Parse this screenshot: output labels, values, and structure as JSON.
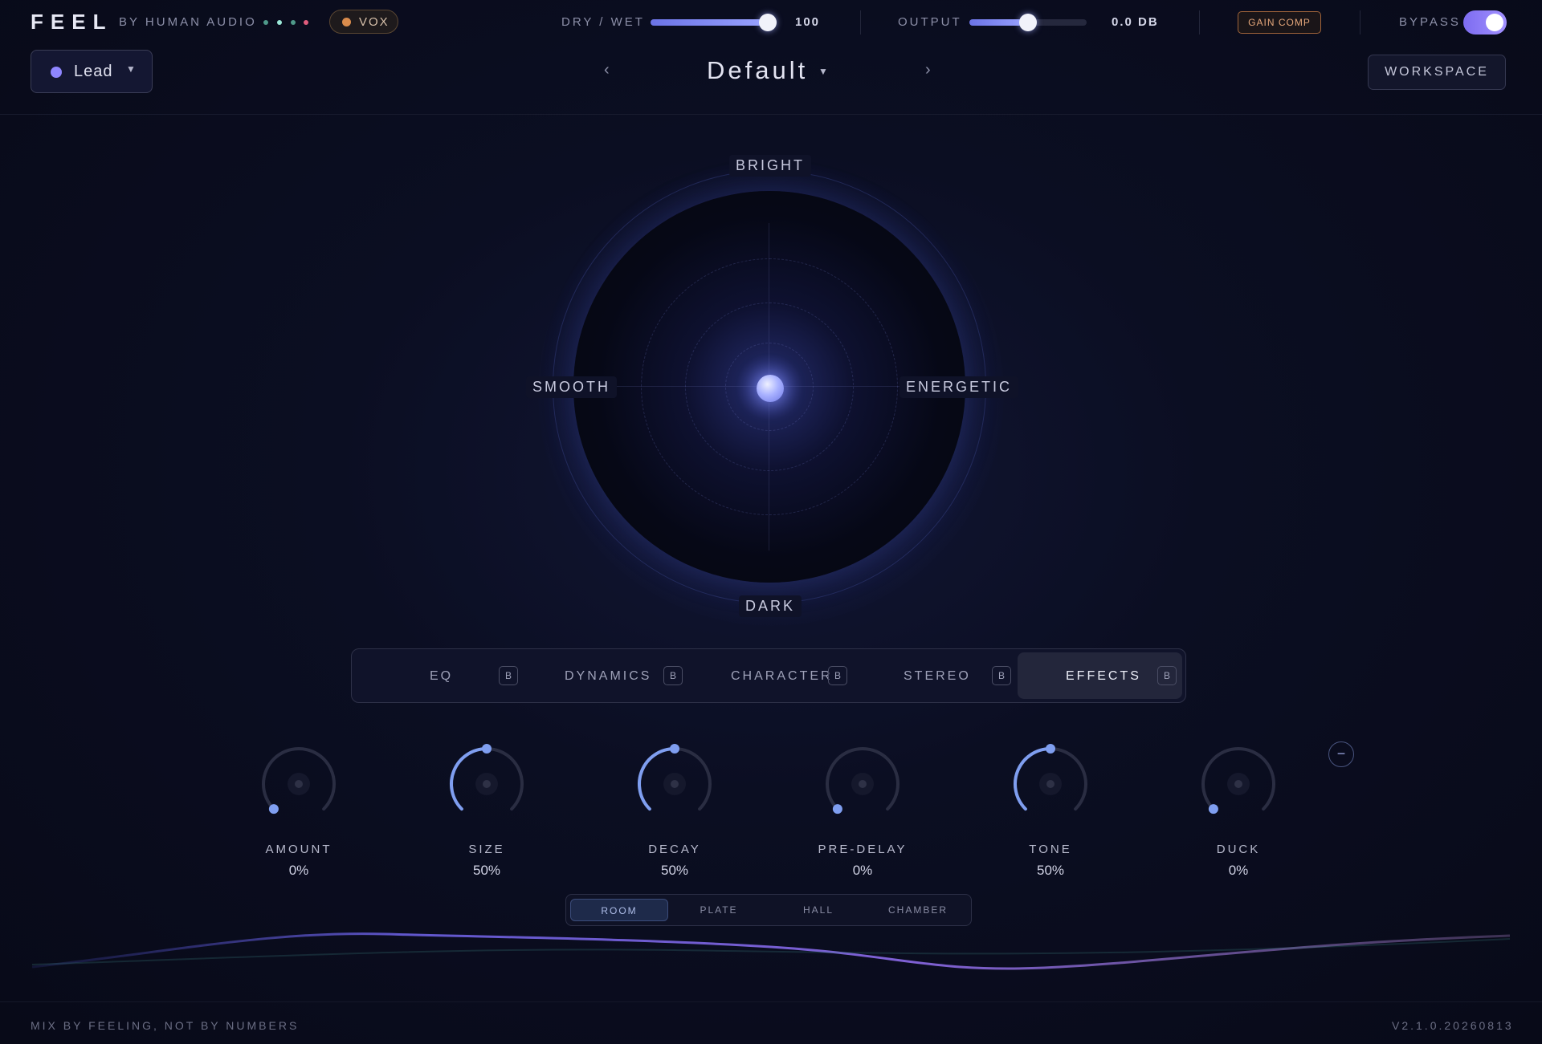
{
  "app": {
    "logo": "FEEL",
    "byline": "BY HUMAN AUDIO"
  },
  "status_dots": [
    "#4f9a8a",
    "#9be8d8",
    "#4f9a8a",
    "#e05c7c"
  ],
  "source_badge": {
    "label": "VOX",
    "color": "#d98b4c"
  },
  "dry_wet": {
    "label": "DRY / WET",
    "value": "100",
    "fraction": 1.0
  },
  "output": {
    "label": "OUTPUT",
    "value": "0.0 DB",
    "fraction": 0.5
  },
  "gain_comp": {
    "label": "GAIN COMP"
  },
  "bypass": {
    "label": "BYPASS",
    "on": true
  },
  "track": {
    "label": "Lead",
    "color": "#8f86ff"
  },
  "preset": {
    "name": "Default",
    "prev": "‹",
    "next": "›"
  },
  "workspace": {
    "label": "WORKSPACE"
  },
  "pad": {
    "top": "BRIGHT",
    "bottom": "DARK",
    "left": "SMOOTH",
    "right": "ENERGETIC",
    "x": 0.0,
    "y": 0.0
  },
  "tabs": [
    {
      "label": "EQ",
      "badge": "B",
      "active": false
    },
    {
      "label": "DYNAMICS",
      "badge": "B",
      "active": false
    },
    {
      "label": "CHARACTER",
      "badge": "B",
      "active": false
    },
    {
      "label": "STEREO",
      "badge": "B",
      "active": false
    },
    {
      "label": "EFFECTS",
      "badge": "B",
      "active": true
    }
  ],
  "knobs": [
    {
      "label": "AMOUNT",
      "value": "0%",
      "fraction": 0.0
    },
    {
      "label": "SIZE",
      "value": "50%",
      "fraction": 0.5
    },
    {
      "label": "DECAY",
      "value": "50%",
      "fraction": 0.5
    },
    {
      "label": "PRE-DELAY",
      "value": "0%",
      "fraction": 0.0
    },
    {
      "label": "TONE",
      "value": "50%",
      "fraction": 0.5
    },
    {
      "label": "DUCK",
      "value": "0%",
      "fraction": 0.0
    }
  ],
  "collapse_button": {
    "label": "−"
  },
  "reverb_types": [
    {
      "label": "ROOM",
      "active": true
    },
    {
      "label": "PLATE",
      "active": false
    },
    {
      "label": "HALL",
      "active": false
    },
    {
      "label": "CHAMBER",
      "active": false
    }
  ],
  "footer": {
    "tagline": "MIX BY FEELING, NOT BY NUMBERS",
    "version": "V2.1.0.20260813"
  },
  "colors": {
    "accent": "#8f86ff",
    "knob_arc": "#7f9ef0",
    "gain_comp": "#e4a67a"
  }
}
